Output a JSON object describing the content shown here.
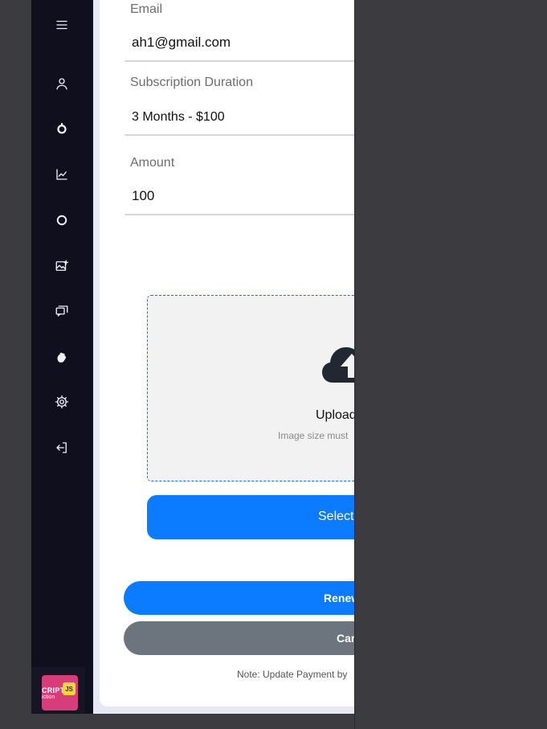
{
  "sidebar": {
    "icons": [
      "menu-icon",
      "user-icon",
      "circle-outline-icon",
      "line-chart-icon",
      "ring-icon",
      "image-add-icon",
      "chat-icon",
      "hand-icon",
      "gear-icon",
      "logout-icon"
    ],
    "app_thumbnail": {
      "line1": "CRIPT",
      "line2": "iction",
      "badge": "JS"
    }
  },
  "form": {
    "email": {
      "label": "Email",
      "value": "ah1@gmail.com"
    },
    "subscription": {
      "label": "Subscription Duration",
      "value": "3 Months - $100"
    },
    "amount": {
      "label": "Amount",
      "value": "100"
    }
  },
  "upload": {
    "icon": "cloud-upload-icon",
    "title": "Upload",
    "hint": "Image size must",
    "select_label": "Select"
  },
  "actions": {
    "renew_label": "Renew",
    "cancel_label": "Car"
  },
  "note": "Note: Update Payment by",
  "colors": {
    "sidebar_bg": "#0f0f1d",
    "primary": "#0b7cff",
    "secondary": "#6c757d",
    "backdrop": "#3c3b40",
    "upload_border": "#1e6fd9"
  }
}
